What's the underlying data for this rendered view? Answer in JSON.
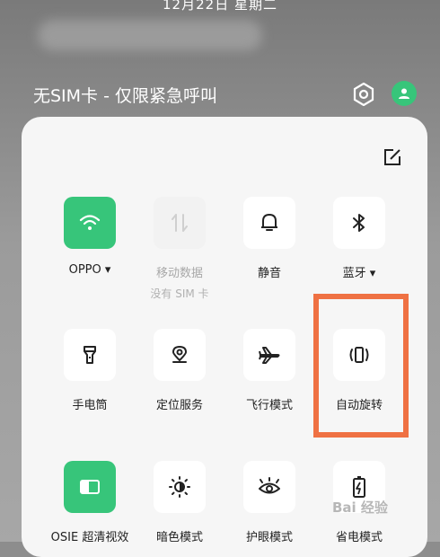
{
  "status": {
    "date": "12月22日  星期二"
  },
  "header": {
    "sim_text": "无SIM卡 - 仅限紧急呼叫"
  },
  "tiles": [
    {
      "label": "OPPO ▾",
      "sub": "",
      "state": "on",
      "icon": "wifi-icon"
    },
    {
      "label": "移动数据",
      "sub": "没有 SIM 卡",
      "state": "disabled",
      "icon": "mobile-data-icon"
    },
    {
      "label": "静音",
      "sub": "",
      "state": "off",
      "icon": "bell-icon"
    },
    {
      "label": "蓝牙 ▾",
      "sub": "",
      "state": "off",
      "icon": "bluetooth-icon"
    },
    {
      "label": "手电筒",
      "sub": "",
      "state": "off",
      "icon": "flashlight-icon"
    },
    {
      "label": "定位服务",
      "sub": "",
      "state": "off",
      "icon": "location-icon"
    },
    {
      "label": "飞行模式",
      "sub": "",
      "state": "off",
      "icon": "airplane-icon"
    },
    {
      "label": "自动旋转",
      "sub": "",
      "state": "off",
      "icon": "auto-rotate-icon"
    },
    {
      "label": "OSIE 超清视效",
      "sub": "",
      "state": "on",
      "icon": "osie-icon"
    },
    {
      "label": "暗色模式",
      "sub": "",
      "state": "off",
      "icon": "dark-mode-icon"
    },
    {
      "label": "护眼模式",
      "sub": "",
      "state": "off",
      "icon": "eye-icon"
    },
    {
      "label": "省电模式",
      "sub": "",
      "state": "off",
      "icon": "battery-icon"
    }
  ],
  "colors": {
    "accent": "#37c57a",
    "highlight": "#ef7143"
  },
  "watermark": "Bai 经验"
}
